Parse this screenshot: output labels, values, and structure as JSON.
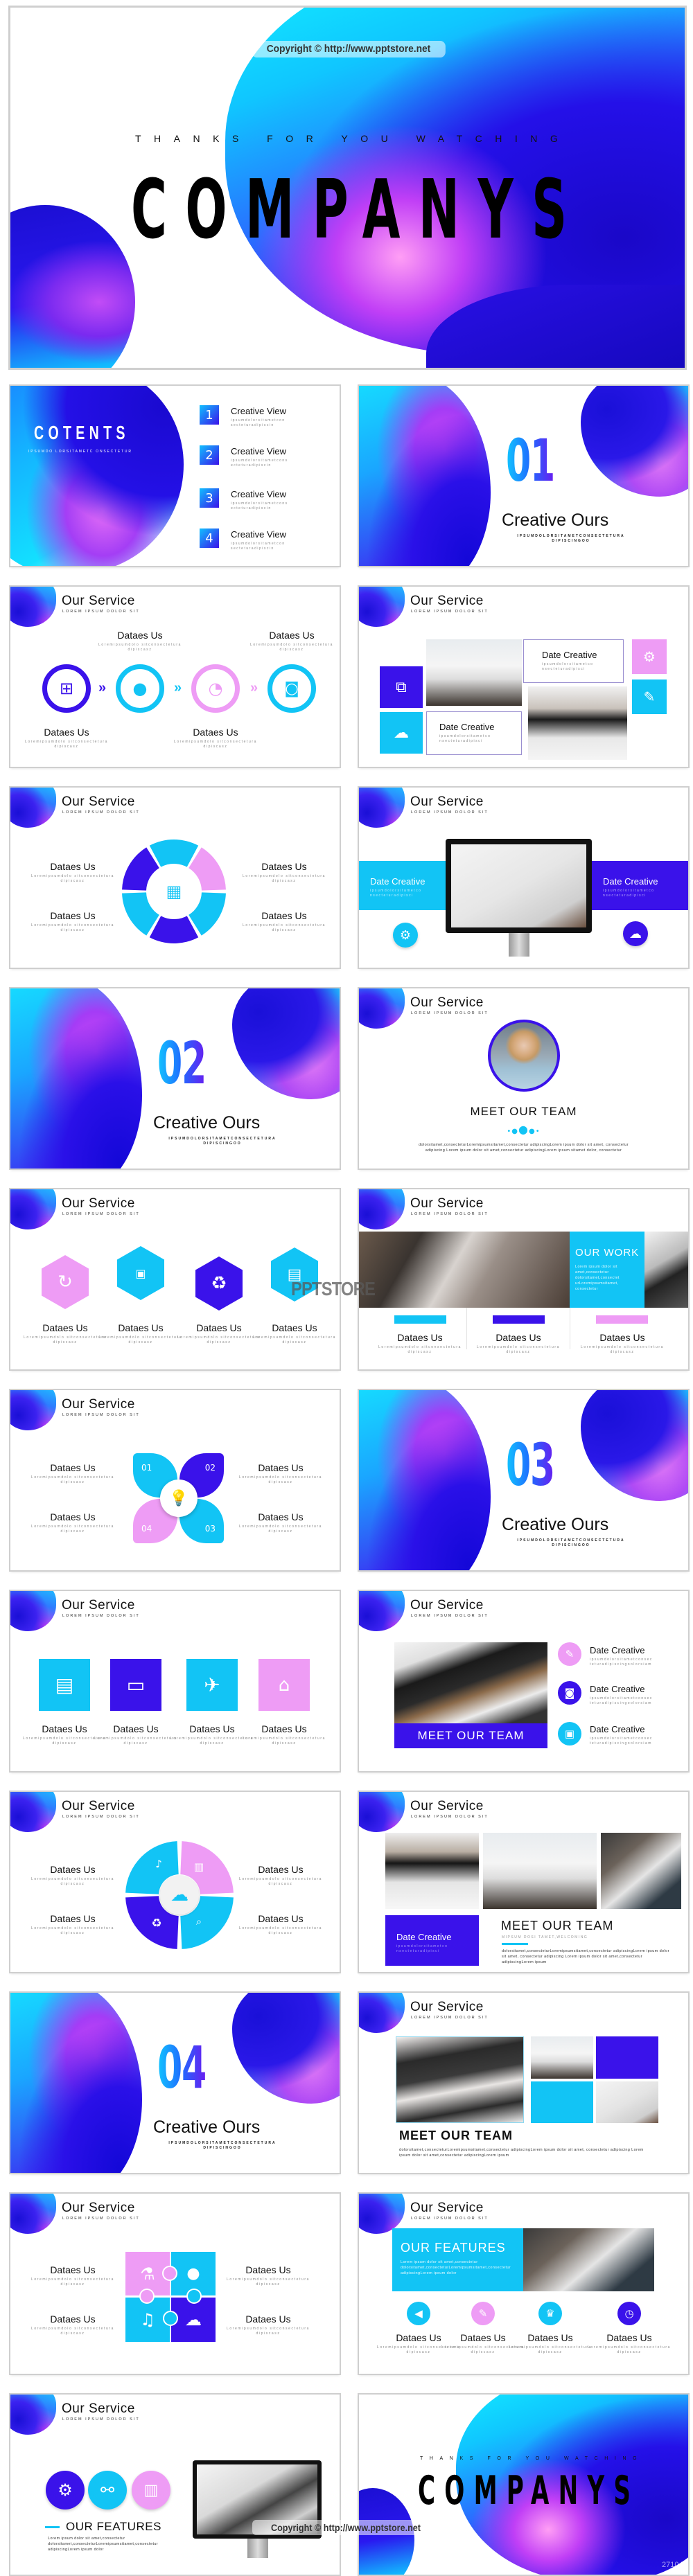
{
  "hero": {
    "copyright": "Copyright © http://www.pptstore.net",
    "subtitle": "THANKS FOR YOU WATCHING",
    "title": "COMPANYS"
  },
  "colors": {
    "cyan": "#12c4f5",
    "purple": "#3a12ea",
    "pink": "#ee9cf5",
    "dark": "#111111"
  },
  "common": {
    "service_title": "Our Service",
    "service_sub": "LOREM IPSUM DOLOR SIT",
    "dataes_us": "Dataes Us",
    "lorem_short": "Loremipsumdolo sitconsectetura dipiscasz",
    "date_creative": "Date Creative",
    "date_desc": "ipsumdolorsitametco nsecteturadipisci",
    "date_desc_long": "ipsumdolorsitametconsec teturadipiscingoolorsiam",
    "meet_team": "MEET OUR TEAM",
    "creative_ours": "Creative Ours",
    "section_desc": "IPSUMDOLORSITAMETCONSECTETURA DIPISCINGOO"
  },
  "contents": {
    "title": "COTENTS",
    "subtitle": "IPSUMDO LORSITAMETC ONSECTETUR",
    "items": [
      {
        "num": "1",
        "label": "Creative View",
        "desc": "ipsumdolorsitametcon secteturadipiscin"
      },
      {
        "num": "2",
        "label": "Creative View",
        "desc": "ipsumdolorsitametcons ecteturadipiscin"
      },
      {
        "num": "3",
        "label": "Creative View",
        "desc": "ipsumdolorsitametcons ecteturadipiscin"
      },
      {
        "num": "4",
        "label": "Creative View",
        "desc": "ipsumdolorsitametcon secteturadipiscin"
      }
    ]
  },
  "sections": [
    "01",
    "02",
    "03",
    "04"
  ],
  "team_avatar": {
    "paragraph": "dolorsitamet,consecteturLoremipsumsitamet,consectetur adipiscingLorem ipsum dolor sit amet, consectetur adipiscing Lorem ipsum dolor sit amet,consectetur adipiscingLorem ipsum sitamet dolor, consectetur"
  },
  "our_work": {
    "title": "OUR WORK",
    "text": "Lorem ipsum dolor sit amet,consectetur dolorsitamet,consectet urLoremipsumsitamet, consectetur",
    "watermark": "PPTSTORE"
  },
  "petals": [
    "01",
    "02",
    "03",
    "04"
  ],
  "team_photos": {
    "subtitle": "MIPSUM DOSI TAMET,WELCOMING",
    "paragraph": "dolorsitamet,consecteturLoremipsumsitamet,consectetur adipiscingLorem ipsum dolor sit amet, consectetur adipiscing Lorem ipsum dolor sit amet,consectetur adipiscingLorem ipsum"
  },
  "team_grid": {
    "paragraph": "dolorsitamet,consecteturLoremipsumsitamet,consectetur adipiscingLorem ipsum dolor sit amet, consectetur adipiscing Lorem ipsum dolor sit amet,consectetur adipiscingLorem ipsum"
  },
  "features": {
    "title": "OUR FEATURES",
    "text": "Lorem ipsum dolor sit amet,consectetur dolorsitamet,consecteturLoremipsumsitamet,consectetur adipiscingLorem ipsum dolor"
  },
  "final": {
    "subtitle": "THANKS FOR YOU WATCHING",
    "title": "COMPANYS",
    "copyright": "Copyright © http://www.pptstore.net",
    "number": "27104"
  }
}
